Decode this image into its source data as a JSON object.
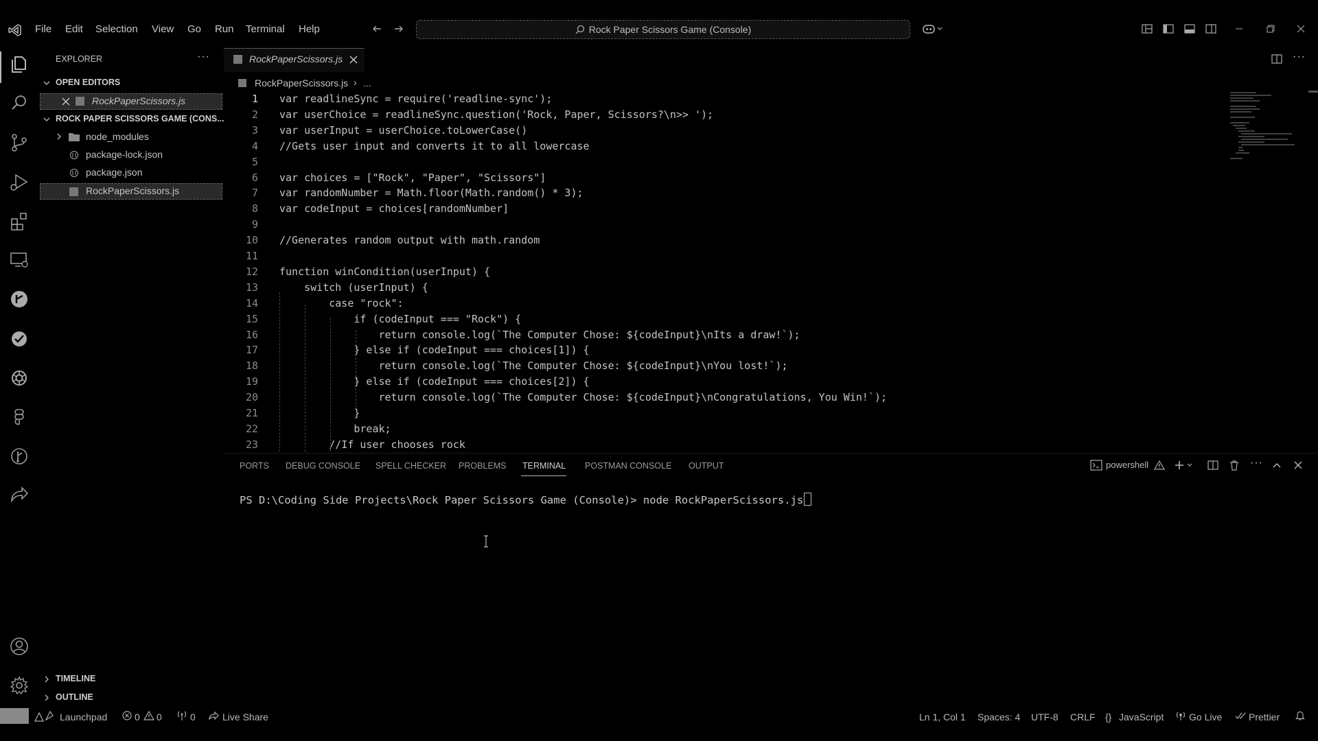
{
  "menu": [
    "File",
    "Edit",
    "Selection",
    "View",
    "Go",
    "Run",
    "Terminal",
    "Help"
  ],
  "search": {
    "text": "Rock Paper Scissors Game (Console)"
  },
  "explorer": {
    "title": "EXPLORER",
    "open_editors_label": "OPEN EDITORS",
    "open_editor_file": "RockPaperScissors.js",
    "project_label": "ROCK PAPER SCISSORS GAME (CONS...",
    "files": [
      "node_modules",
      "package-lock.json",
      "package.json",
      "RockPaperScissors.js"
    ],
    "timeline_label": "TIMELINE",
    "outline_label": "OUTLINE"
  },
  "editor": {
    "tab_label": "RockPaperScissors.js",
    "breadcrumb_file": "RockPaperScissors.js",
    "breadcrumb_more": "...",
    "lines": [
      "var readlineSync = require('readline-sync');",
      "var userChoice = readlineSync.question('Rock, Paper, Scissors?\\n>> ');",
      "var userInput = userChoice.toLowerCase()",
      "//Gets user input and converts it to all lowercase",
      "",
      "var choices = [\"Rock\", \"Paper\", \"Scissors\"]",
      "var randomNumber = Math.floor(Math.random() * 3);",
      "var codeInput = choices[randomNumber]",
      "",
      "//Generates random output with math.random",
      "",
      "function winCondition(userInput) {",
      "    switch (userInput) {",
      "        case \"rock\":",
      "            if (codeInput === \"Rock\") {",
      "                return console.log(`The Computer Chose: ${codeInput}\\nIts a draw!`);",
      "            } else if (codeInput === choices[1]) {",
      "                return console.log(`The Computer Chose: ${codeInput}\\nYou lost!`);",
      "            } else if (codeInput === choices[2]) {",
      "                return console.log(`The Computer Chose: ${codeInput}\\nCongratulations, You Win!`);",
      "            }",
      "            break;",
      "        //If user chooses rock"
    ]
  },
  "panel": {
    "tabs": [
      "PORTS",
      "DEBUG CONSOLE",
      "SPELL CHECKER",
      "PROBLEMS",
      "TERMINAL",
      "POSTMAN CONSOLE",
      "OUTPUT"
    ],
    "active_tab": "TERMINAL",
    "shell_label": "powershell",
    "terminal_line": "PS D:\\Coding Side Projects\\Rock Paper Scissors Game (Console)> node RockPaperScissors.js"
  },
  "status": {
    "launchpad": "Launchpad",
    "errors": "0",
    "warnings": "0",
    "ports": "0",
    "live_share": "Live Share",
    "position": "Ln 1, Col 1",
    "spaces": "Spaces: 4",
    "encoding": "UTF-8",
    "eol": "CRLF",
    "language": "JavaScript",
    "go_live": "Go Live",
    "prettier": "Prettier"
  },
  "icons": [
    "vscode-logo-icon",
    "explorer-icon",
    "search-icon",
    "source-control-icon",
    "run-debug-icon",
    "extensions-icon",
    "remote-explorer-icon",
    "gitlens-icon",
    "testing-icon",
    "chatgpt-icon",
    "figma-icon",
    "git-graph-icon",
    "live-share-icon",
    "account-icon",
    "settings-gear-icon"
  ]
}
